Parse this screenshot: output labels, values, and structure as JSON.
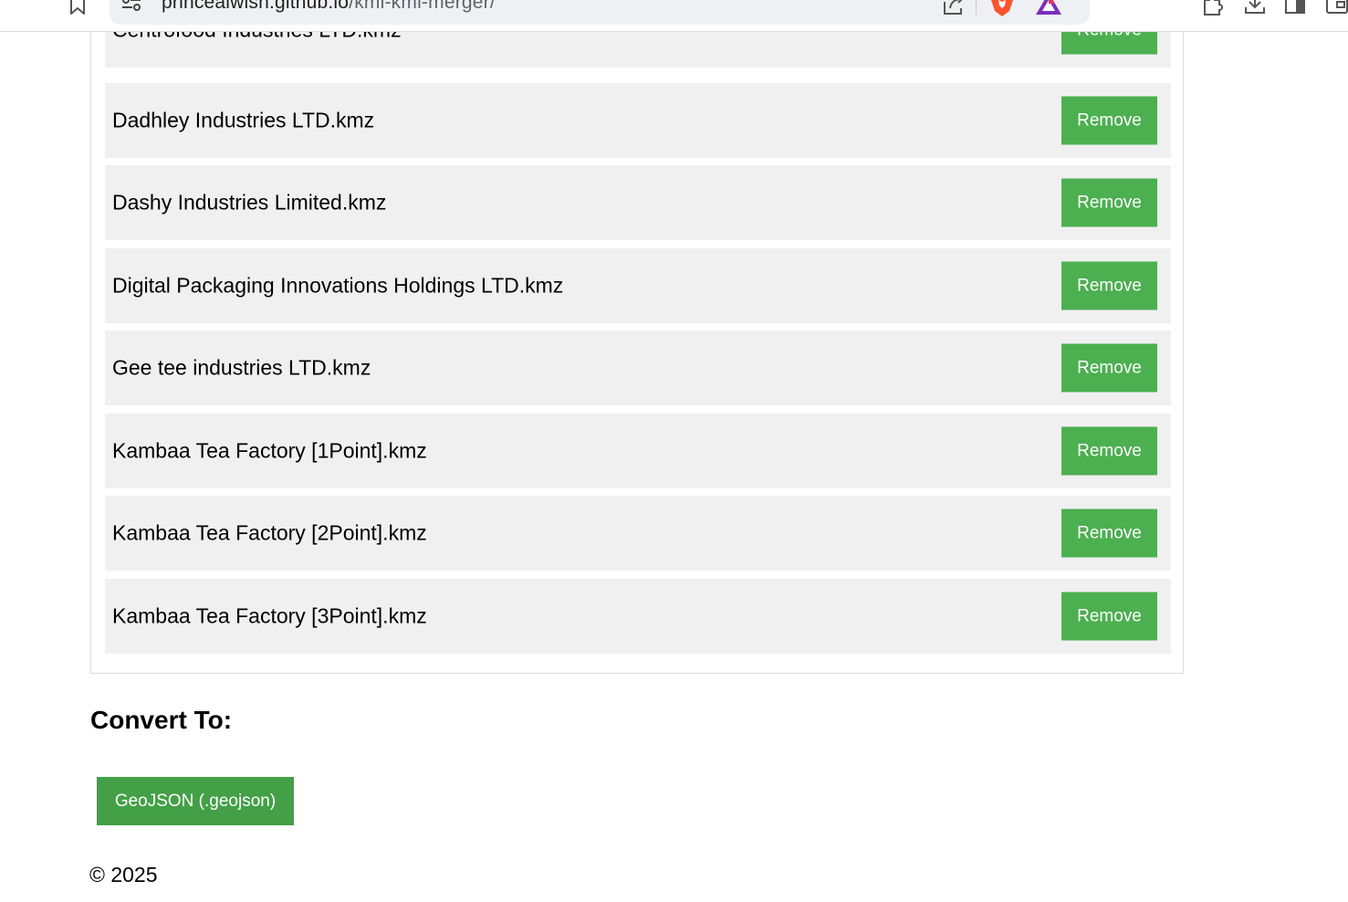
{
  "browser": {
    "url_host": "princealwish.github.io",
    "url_path": "/kml-kml-merger/"
  },
  "files": [
    {
      "name": "Centrofood Industries LTD.kmz",
      "remove_label": "Remove"
    },
    {
      "name": "Dadhley Industries LTD.kmz",
      "remove_label": "Remove"
    },
    {
      "name": "Dashy Industries Limited.kmz",
      "remove_label": "Remove"
    },
    {
      "name": "Digital Packaging Innovations Holdings LTD.kmz",
      "remove_label": "Remove"
    },
    {
      "name": "Gee tee industries LTD.kmz",
      "remove_label": "Remove"
    },
    {
      "name": "Kambaa Tea Factory [1Point].kmz",
      "remove_label": "Remove"
    },
    {
      "name": "Kambaa Tea Factory [2Point].kmz",
      "remove_label": "Remove"
    },
    {
      "name": "Kambaa Tea Factory [3Point].kmz",
      "remove_label": "Remove"
    }
  ],
  "convert": {
    "heading": "Convert To:",
    "geojson_label": "GeoJSON (.geojson)"
  },
  "footer": {
    "copyright": "© 2025"
  },
  "colors": {
    "button_green": "#4caf50",
    "item_background": "#f0f0f0"
  }
}
